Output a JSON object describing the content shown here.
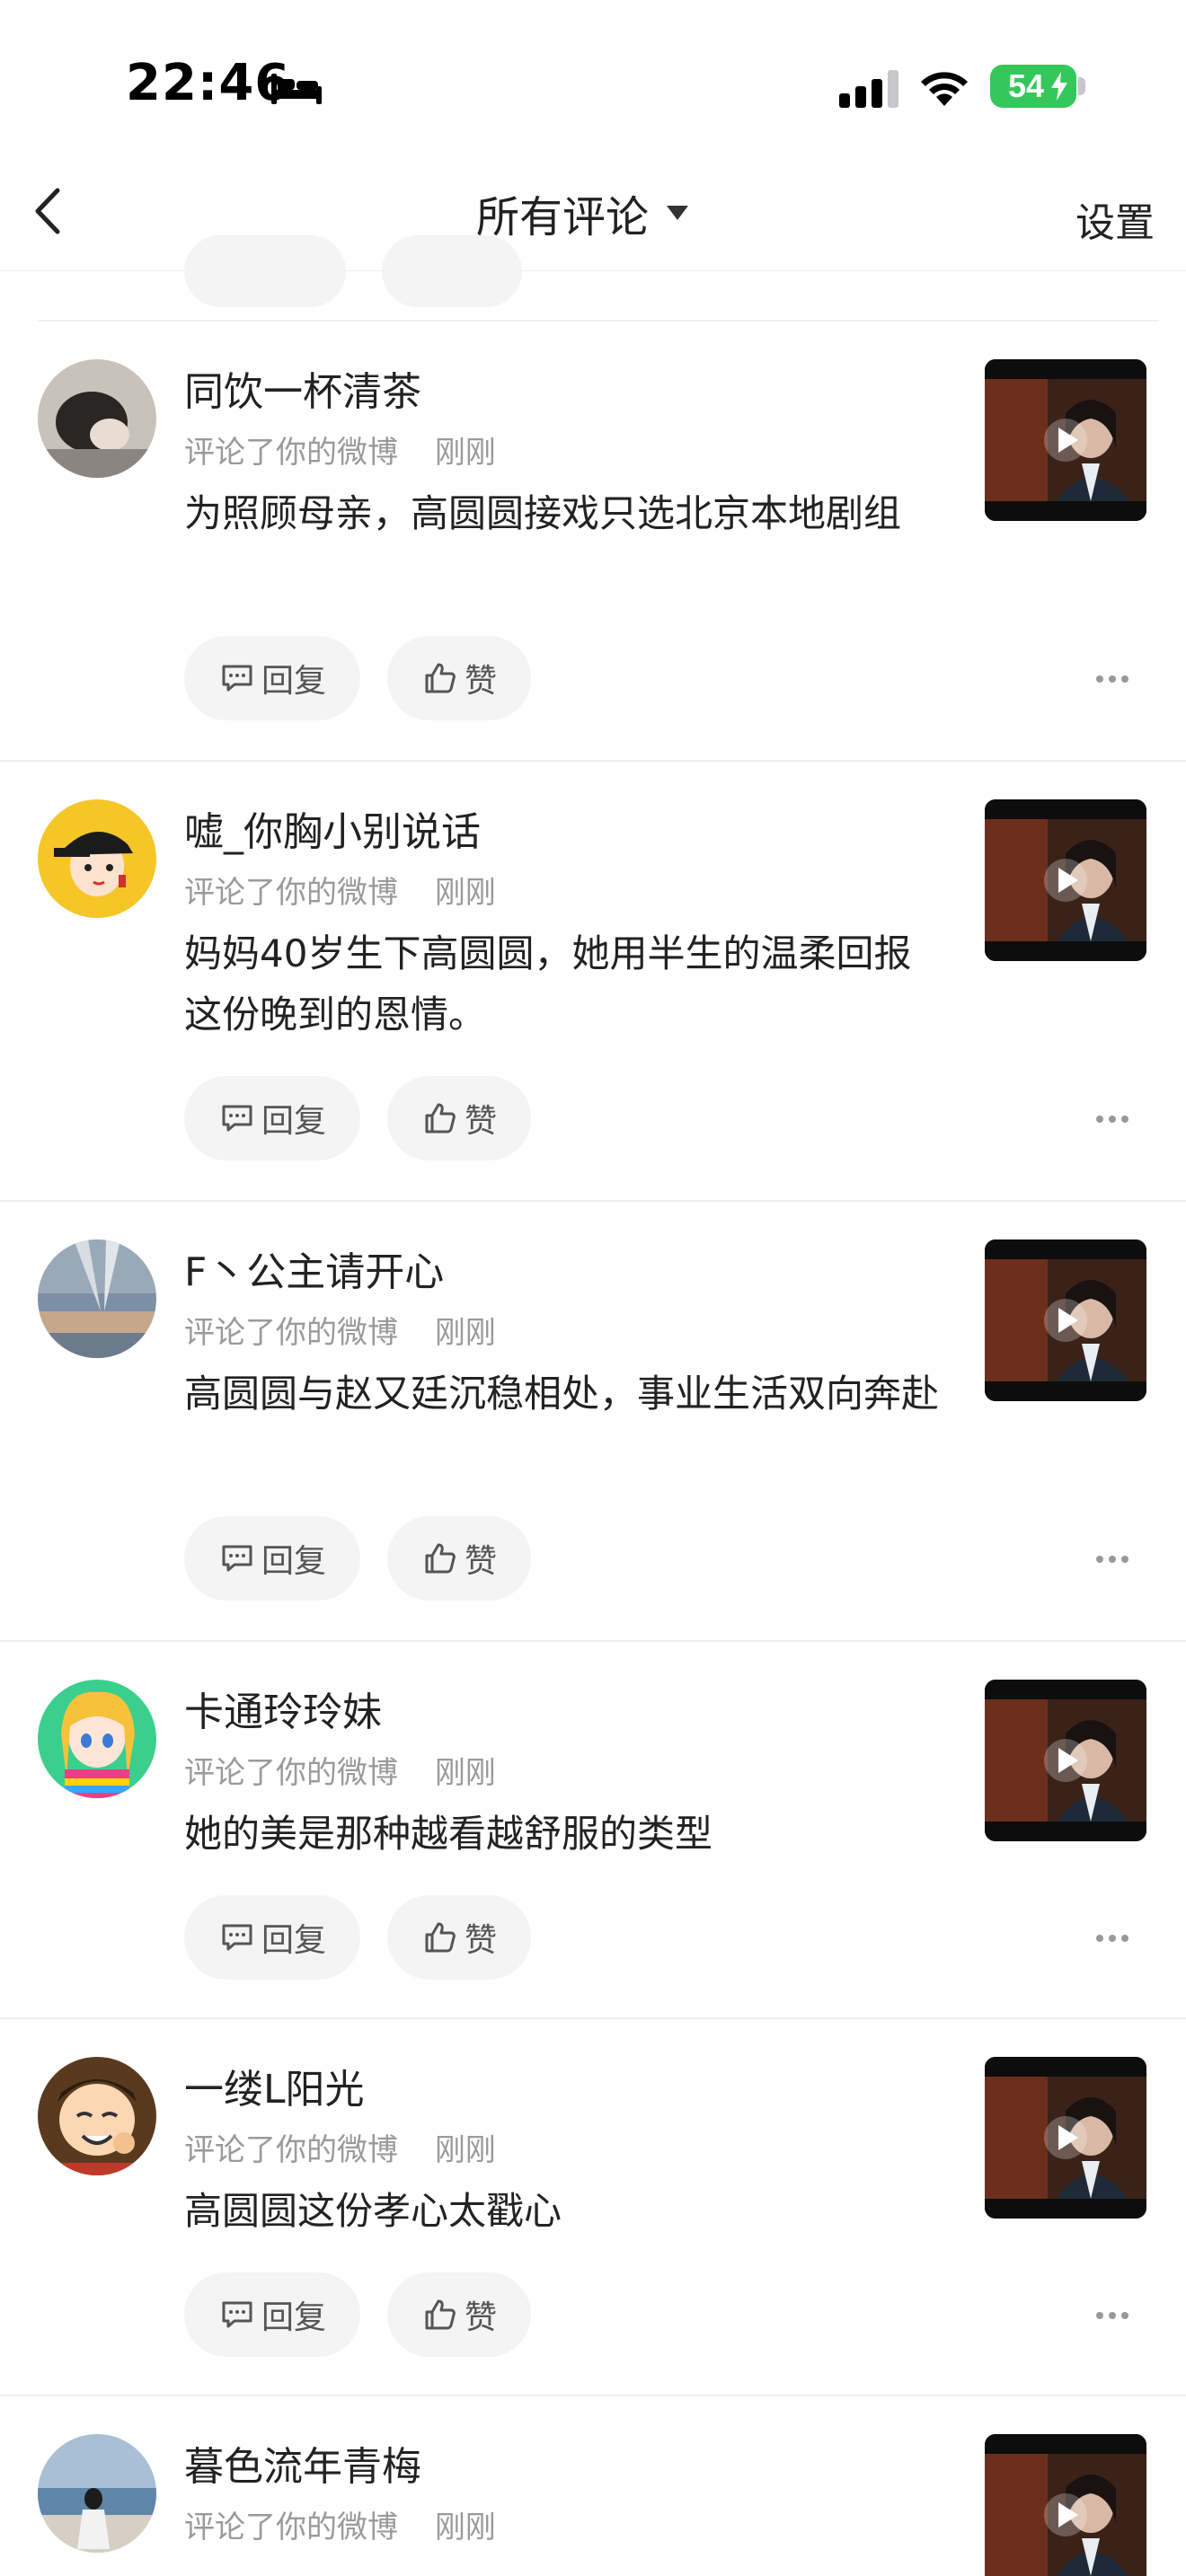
{
  "status_bar": {
    "time": "22:46",
    "battery": "54"
  },
  "nav": {
    "title": "所有评论",
    "settings": "设置"
  },
  "actions": {
    "reply": "回复",
    "like": "赞"
  },
  "comments": [
    {
      "user": "同饮一杯清茶",
      "meta": "评论了你的微博",
      "time": "刚刚",
      "text": "为照顾母亲，高圆圆接戏只选北京本地剧组"
    },
    {
      "user": "嘘_你胸小别说话",
      "meta": "评论了你的微博",
      "time": "刚刚",
      "text": "妈妈40岁生下高圆圆，她用半生的温柔回报这份晚到的恩情。"
    },
    {
      "user": "F丶公主请开心",
      "meta": "评论了你的微博",
      "time": "刚刚",
      "text": "高圆圆与赵又廷沉稳相处，事业生活双向奔赴"
    },
    {
      "user": "卡通玲玲妹",
      "meta": "评论了你的微博",
      "time": "刚刚",
      "text": "她的美是那种越看越舒服的类型"
    },
    {
      "user": "一缕L阳光",
      "meta": "评论了你的微博",
      "time": "刚刚",
      "text": "高圆圆这份孝心太戳心"
    },
    {
      "user": "暮色流年青梅",
      "meta": "评论了你的微博",
      "time": "刚刚",
      "text": ""
    }
  ]
}
